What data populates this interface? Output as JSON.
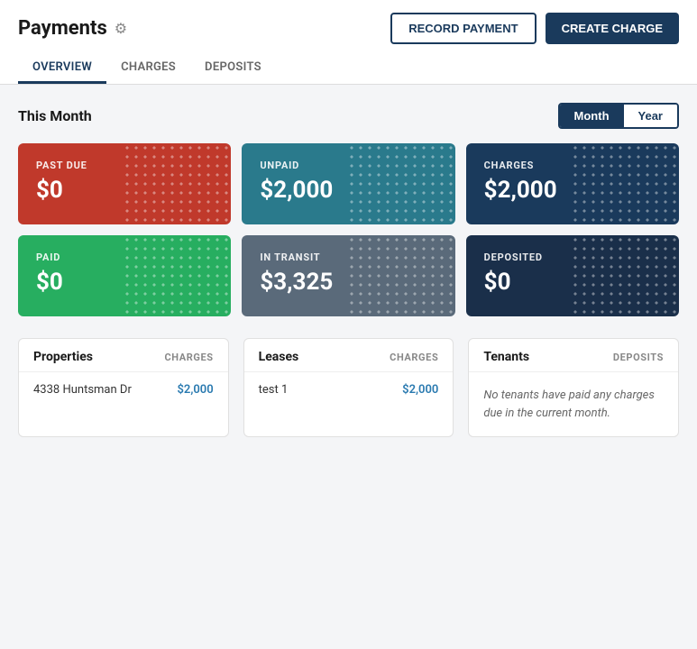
{
  "page": {
    "title": "Payments",
    "gear_label": "⚙"
  },
  "header_buttons": {
    "record": "RECORD PAYMENT",
    "create": "CREATE CHARGE"
  },
  "nav": {
    "tabs": [
      {
        "id": "overview",
        "label": "OVERVIEW",
        "active": true
      },
      {
        "id": "charges",
        "label": "CHARGES",
        "active": false
      },
      {
        "id": "deposits",
        "label": "DEPOSITS",
        "active": false
      }
    ]
  },
  "section": {
    "title": "This Month",
    "toggle": {
      "month": "Month",
      "year": "Year",
      "active": "month"
    }
  },
  "cards": [
    {
      "id": "past-due",
      "label": "PAST DUE",
      "value": "$0",
      "color": "card-red"
    },
    {
      "id": "unpaid",
      "label": "UNPAID",
      "value": "$2,000",
      "color": "card-teal"
    },
    {
      "id": "charges",
      "label": "CHARGES",
      "value": "$2,000",
      "color": "card-dark-blue"
    },
    {
      "id": "paid",
      "label": "PAID",
      "value": "$0",
      "color": "card-green"
    },
    {
      "id": "in-transit",
      "label": "IN TRANSIT",
      "value": "$3,325",
      "color": "card-gray"
    },
    {
      "id": "deposited",
      "label": "DEPOSITED",
      "value": "$0",
      "color": "card-navy"
    }
  ],
  "properties": {
    "header": "Properties",
    "column": "CHARGES",
    "items": [
      {
        "name": "4338 Huntsman Dr",
        "value": "$2,000"
      }
    ]
  },
  "leases": {
    "header": "Leases",
    "column": "CHARGES",
    "items": [
      {
        "name": "test 1",
        "value": "$2,000"
      }
    ]
  },
  "tenants": {
    "header": "Tenants",
    "column": "DEPOSITS",
    "empty_message": "No tenants have paid any charges due in the current month."
  }
}
